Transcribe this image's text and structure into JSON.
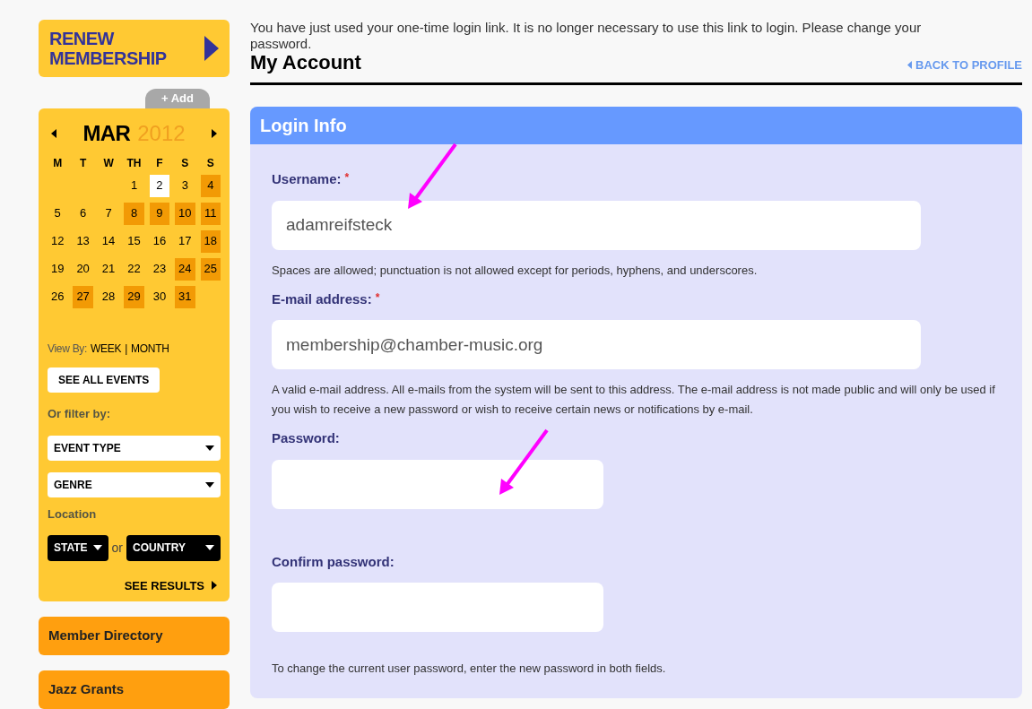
{
  "sidebar": {
    "renew_button": "RENEW MEMBERSHIP",
    "add_tab": "+ Add",
    "calendar": {
      "month": "MAR",
      "year": "2012",
      "weekdays": [
        "M",
        "T",
        "W",
        "TH",
        "F",
        "S",
        "S"
      ],
      "weeks": [
        [
          {
            "kind": "blank"
          },
          {
            "kind": "blank"
          },
          {
            "kind": "blank"
          },
          {
            "kind": "day",
            "day": "1",
            "has_events": false,
            "today": false
          },
          {
            "kind": "day",
            "day": "2",
            "today": true
          },
          {
            "kind": "day",
            "day": "3",
            "has_events": false,
            "today": false
          },
          {
            "kind": "day",
            "day": "4",
            "has_events": true,
            "today": false
          }
        ],
        [
          {
            "kind": "day",
            "day": "5",
            "has_events": false,
            "today": false
          },
          {
            "kind": "day",
            "day": "6",
            "has_events": false,
            "today": false
          },
          {
            "kind": "day",
            "day": "7",
            "has_events": false,
            "today": false
          },
          {
            "kind": "day",
            "day": "8",
            "has_events": true,
            "today": false
          },
          {
            "kind": "day",
            "day": "9",
            "has_events": true,
            "today": false
          },
          {
            "kind": "day",
            "day": "10",
            "has_events": true,
            "today": false
          },
          {
            "kind": "day",
            "day": "11",
            "has_events": true,
            "today": false
          }
        ],
        [
          {
            "kind": "day",
            "day": "12",
            "has_events": false,
            "today": false
          },
          {
            "kind": "day",
            "day": "13",
            "has_events": false,
            "today": false
          },
          {
            "kind": "day",
            "day": "14",
            "has_events": false,
            "today": false
          },
          {
            "kind": "day",
            "day": "15",
            "has_events": false,
            "today": false
          },
          {
            "kind": "day",
            "day": "16",
            "has_events": false,
            "today": false
          },
          {
            "kind": "day",
            "day": "17",
            "has_events": false,
            "today": false
          },
          {
            "kind": "day",
            "day": "18",
            "has_events": true,
            "today": false
          }
        ],
        [
          {
            "kind": "day",
            "day": "19",
            "has_events": false,
            "today": false
          },
          {
            "kind": "day",
            "day": "20",
            "has_events": false,
            "today": false
          },
          {
            "kind": "day",
            "day": "21",
            "has_events": false,
            "today": false
          },
          {
            "kind": "day",
            "day": "22",
            "has_events": false,
            "today": false
          },
          {
            "kind": "day",
            "day": "23",
            "has_events": false,
            "today": false
          },
          {
            "kind": "day",
            "day": "24",
            "has_events": true,
            "today": false
          },
          {
            "kind": "day",
            "day": "25",
            "has_events": true,
            "today": false
          }
        ],
        [
          {
            "kind": "day",
            "day": "26",
            "has_events": false,
            "today": false
          },
          {
            "kind": "day",
            "day": "27",
            "has_events": true,
            "today": false
          },
          {
            "kind": "day",
            "day": "28",
            "has_events": false,
            "today": false
          },
          {
            "kind": "day",
            "day": "29",
            "has_events": true,
            "today": false
          },
          {
            "kind": "day",
            "day": "30",
            "has_events": false,
            "today": false
          },
          {
            "kind": "day",
            "day": "31",
            "has_events": true,
            "today": false
          },
          {
            "kind": "blank"
          }
        ]
      ]
    },
    "view_by_label": "View By:",
    "view_week": "WEEK",
    "view_separator": "|",
    "view_month": "MONTH",
    "see_all_button": "SEE ALL EVENTS",
    "filter_label": "Or filter by:",
    "event_type_select": "EVENT TYPE",
    "genre_select": "GENRE",
    "location_label": "Location",
    "state_select": "STATE",
    "or_text": "or",
    "country_select": "COUNTRY",
    "see_results": "SEE RESULTS",
    "nav_items": [
      "Member Directory",
      "Jazz Grants"
    ]
  },
  "main": {
    "notice": "You have just used your one-time login link. It is no longer necessary to use this link to login. Please change your password.",
    "title": "My Account",
    "back_link": "BACK TO PROFILE",
    "panel_title": "Login Info",
    "fields": [
      {
        "label": "Username:",
        "required_mark": "*",
        "value": "adamreifsteck",
        "description": "Spaces are allowed; punctuation is not allowed except for periods, hyphens, and underscores.",
        "wide": true
      },
      {
        "label": "E-mail address:",
        "required_mark": "*",
        "value": "membership@chamber-music.org",
        "description": "A valid e-mail address. All e-mails from the system will be sent to this address. The e-mail address is not made public and will only be used if you wish to receive a new password or wish to receive certain news or notifications by e-mail.",
        "wide": true
      },
      {
        "label": "Password:",
        "wide": false
      },
      {
        "label": "Confirm password:",
        "wide": false,
        "description": "To change the current user password, enter the new password in both fields."
      }
    ]
  }
}
